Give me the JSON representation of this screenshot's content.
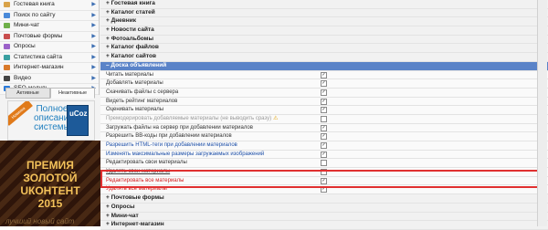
{
  "sidebar": {
    "items": [
      {
        "label": "Гостевая книга",
        "icon": "book-icon"
      },
      {
        "label": "Поиск по сайту",
        "icon": "search-icon"
      },
      {
        "label": "Мини-чат",
        "icon": "chat-icon"
      },
      {
        "label": "Почтовые формы",
        "icon": "mail-icon"
      },
      {
        "label": "Опросы",
        "icon": "poll-icon"
      },
      {
        "label": "Статистика сайта",
        "icon": "stats-icon"
      },
      {
        "label": "Интернет-магазин",
        "icon": "shop-icon"
      },
      {
        "label": "Видео",
        "icon": "video-icon"
      },
      {
        "label": "SEO-модуль",
        "icon": "seo-icon"
      }
    ],
    "tabs": [
      {
        "label": "Активные"
      },
      {
        "label": "Неактивные"
      }
    ],
    "banner1": {
      "ribbon": "Новинка",
      "line1": "Полное",
      "line2": "описание",
      "line3": "системы",
      "box_brand": "uCoz"
    },
    "banner2": {
      "line1": "ПРЕМИЯ",
      "line2": "ЗОЛОТОЙ",
      "line3": "UКОНТЕНТ",
      "line4": "2015",
      "line5": "лучший новый сайт"
    }
  },
  "content": {
    "sections_top": [
      {
        "label": "+ Гостевая книга"
      },
      {
        "label": "+ Каталог статей"
      },
      {
        "label": "+ Дневник"
      },
      {
        "label": "+ Новости сайта"
      },
      {
        "label": "+ Фотоальбомы"
      },
      {
        "label": "+ Каталог файлов"
      },
      {
        "label": "+ Каталог сайтов"
      }
    ],
    "open_section": {
      "label": "– Доска объявлений"
    },
    "permissions": [
      {
        "label": "Читать материалы",
        "checked": true,
        "style": ""
      },
      {
        "label": "Добавлять материалы",
        "checked": true,
        "style": ""
      },
      {
        "label": "Скачивать файлы с сервера",
        "checked": true,
        "style": ""
      },
      {
        "label": "Видеть рейтинг материалов",
        "checked": true,
        "style": ""
      },
      {
        "label": "Оценивать материалы",
        "checked": true,
        "style": ""
      },
      {
        "label": "Премодерировать добавляемые материалы (не выводить сразу)",
        "checked": false,
        "style": "disabled",
        "warn": "⚠"
      },
      {
        "label": "Загружать файлы на сервер при добавлении материалов",
        "checked": true,
        "style": ""
      },
      {
        "label": "Разрешить BB-коды при добавлении материалов",
        "checked": true,
        "style": ""
      },
      {
        "label": "Разрешить HTML-теги при добавлении материалов",
        "checked": true,
        "style": "blue"
      },
      {
        "label": "Изменять максимальные размеры загружаемых изображений",
        "checked": true,
        "style": "blue"
      },
      {
        "label": "Редактировать свои материалы",
        "checked": false,
        "style": ""
      },
      {
        "label": "Удалять свои материалы",
        "checked": false,
        "style": "link"
      },
      {
        "label": "Редактировать все материалы",
        "checked": true,
        "style": "danger"
      },
      {
        "label": "Удалять все материалы",
        "checked": true,
        "style": "danger"
      }
    ],
    "sections_bottom": [
      {
        "label": "+ Почтовые формы"
      },
      {
        "label": "+ Опросы"
      },
      {
        "label": "+ Мини-чат"
      },
      {
        "label": "+ Интернет-магазин"
      }
    ]
  },
  "colors": {
    "accent": "#5a83c8",
    "danger": "#d02020",
    "highlight_border": "#e03030"
  }
}
